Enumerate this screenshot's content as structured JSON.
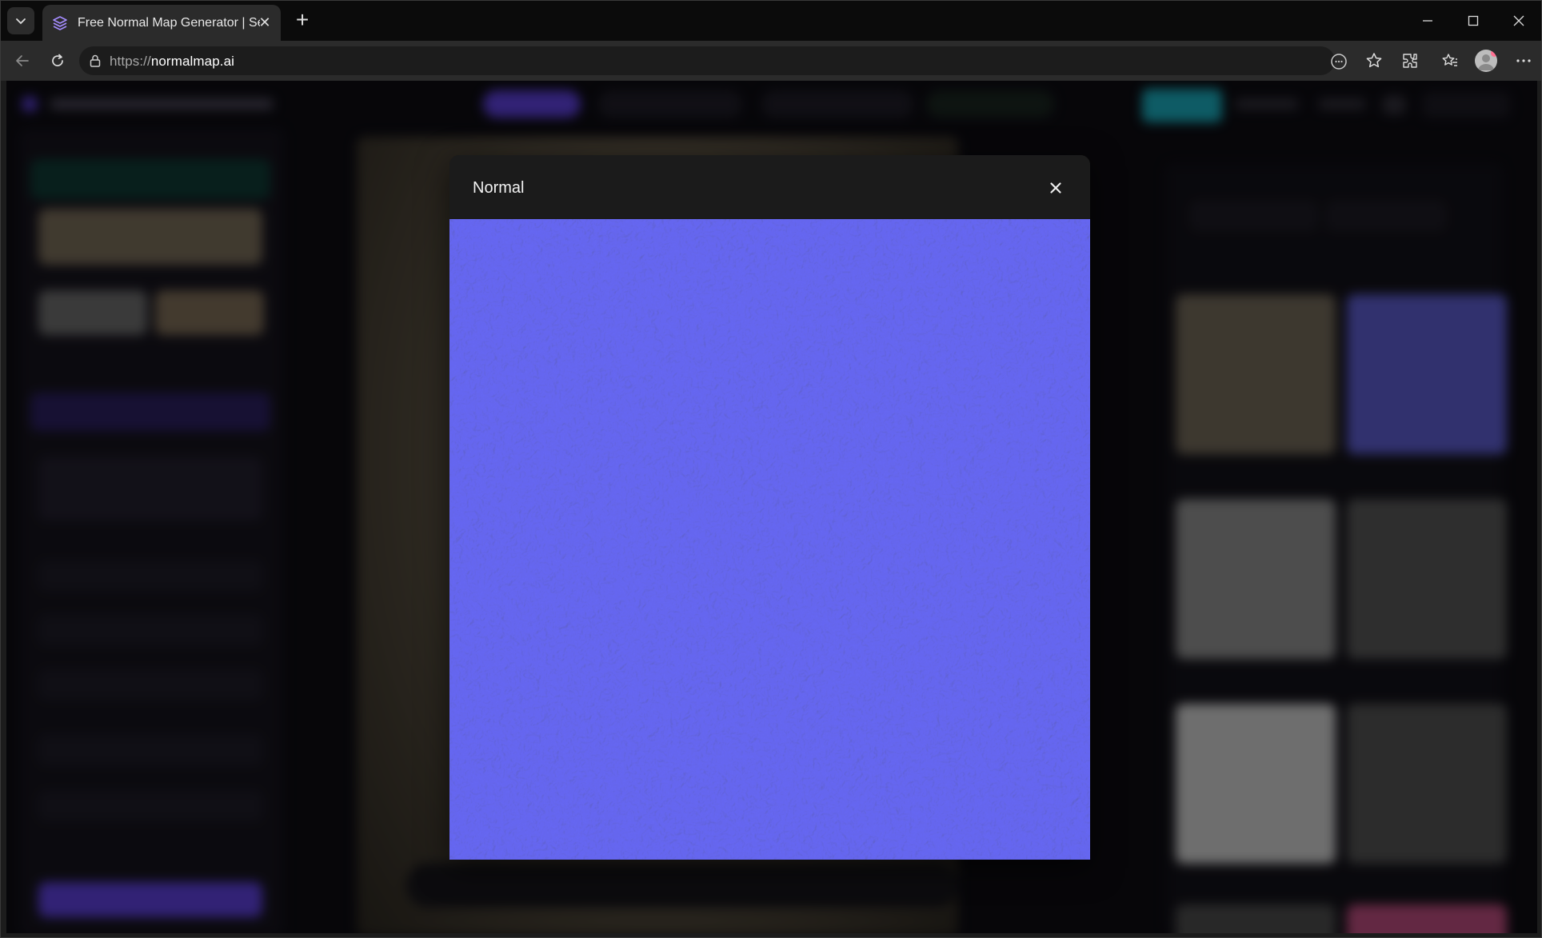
{
  "browser": {
    "tab": {
      "title": "Free Normal Map Generator | Search",
      "favicon": "layers-icon"
    },
    "address": {
      "protocol": "https://",
      "host": "normalmap.ai"
    },
    "icons": [
      "tab-list-icon",
      "close-icon",
      "plus-icon",
      "minimize-icon",
      "maximize-icon",
      "back-icon",
      "reload-icon",
      "lock-icon",
      "reader-icon",
      "star-icon",
      "extensions-icon",
      "favorites-icon",
      "avatar",
      "more-icon"
    ]
  },
  "modal": {
    "title": "Normal",
    "close_icon": "close-icon",
    "image": {
      "kind": "normal-map-texture",
      "base_color": "#8080ff"
    }
  },
  "colors": {
    "normal_base": "#8486f0",
    "primary_purple": "#5b3fd6",
    "accent_teal": "#1aa7b8",
    "page_bg": "#0d0c12"
  }
}
